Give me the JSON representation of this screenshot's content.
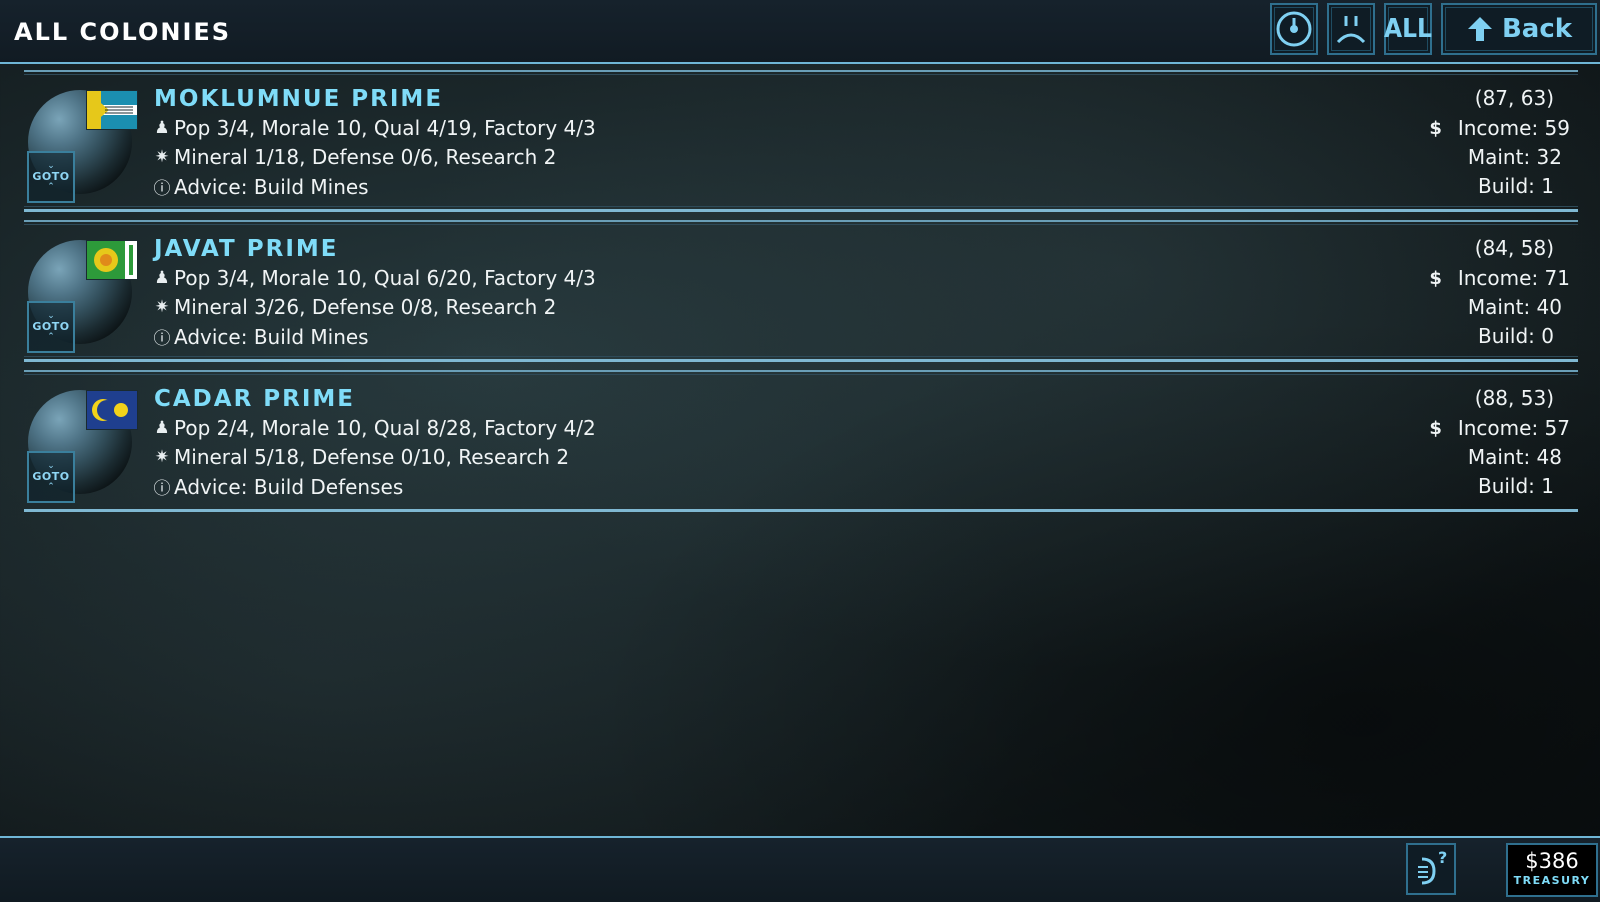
{
  "header": {
    "title": "ALL COLONIES",
    "all_label": "ALL",
    "back_label": "Back"
  },
  "colonies": [
    {
      "name": "MOKLUMNUE PRIME",
      "line1": "Pop 3/4, Morale 10, Qual 4/19, Factory 4/3",
      "line2": "Mineral 1/18, Defense 0/6, Research 2",
      "line3": "Advice: Build Mines",
      "coords": "(87, 63)",
      "income": "Income: 59",
      "maint": "Maint: 32",
      "build": "Build: 1",
      "goto_label": "GOTO"
    },
    {
      "name": "JAVAT PRIME",
      "line1": "Pop 3/4, Morale 10, Qual 6/20, Factory 4/3",
      "line2": "Mineral 3/26, Defense 0/8, Research 2",
      "line3": "Advice: Build Mines",
      "coords": "(84, 58)",
      "income": "Income: 71",
      "maint": "Maint: 40",
      "build": "Build: 0",
      "goto_label": "GOTO"
    },
    {
      "name": "CADAR PRIME",
      "line1": "Pop 2/4, Morale 10, Qual 8/28, Factory 4/2",
      "line2": "Mineral 5/18, Defense 0/10, Research 2",
      "line3": "Advice: Build Defenses",
      "coords": "(88, 53)",
      "income": "Income: 57",
      "maint": "Maint: 48",
      "build": "Build: 1",
      "goto_label": "GOTO"
    }
  ],
  "footer": {
    "treasury_value": "$386",
    "treasury_label": "TREASURY"
  },
  "icons": {
    "header_buttons": [
      "clock-icon",
      "sad-face-icon",
      "back-arrow-icon"
    ],
    "row": [
      "population-icon",
      "mineral-icon",
      "info-icon",
      "dollar-icon"
    ],
    "footer": [
      "help-icon"
    ]
  },
  "colors": {
    "accent": "#7fdcf8",
    "border": "#6fb6d6",
    "background": "#141e21"
  }
}
